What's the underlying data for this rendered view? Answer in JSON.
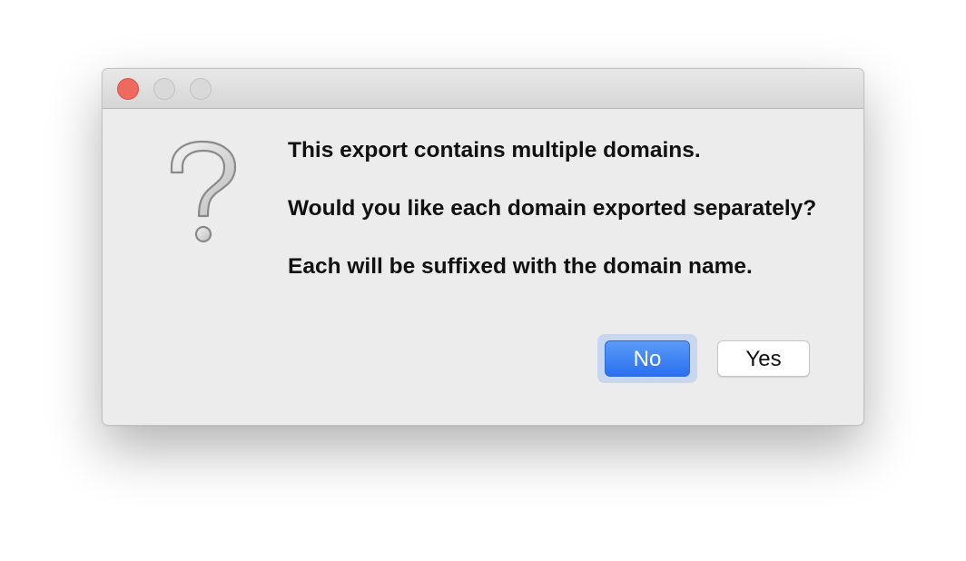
{
  "window": {
    "traffic_lights": {
      "close_color": "#ee6a5e",
      "minimize_color": "#d9d9d9",
      "zoom_color": "#d9d9d9"
    }
  },
  "icon": "question-mark-icon",
  "message": {
    "line1": "This export contains multiple domains.",
    "line2": "Would you like each domain exported separately?",
    "line3": "Each will be suffixed with the domain name."
  },
  "buttons": {
    "no_label": "No",
    "yes_label": "Yes"
  },
  "colors": {
    "default_button": "#2a6ff0",
    "dialog_background": "#ececec"
  }
}
